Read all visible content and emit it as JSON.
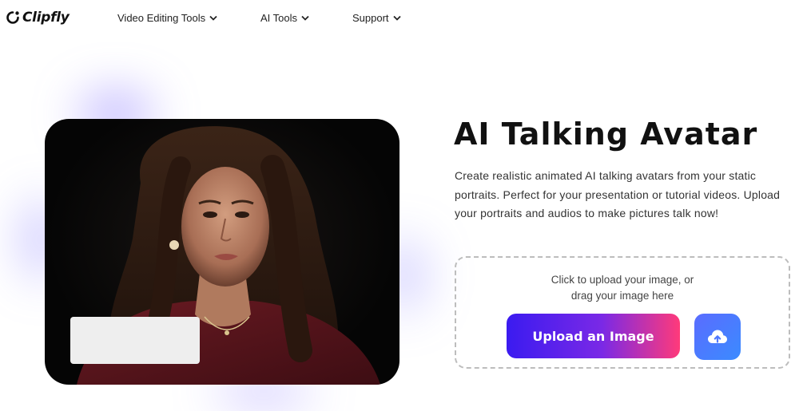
{
  "brand": {
    "name": "Clipfly"
  },
  "nav": {
    "items": [
      {
        "label": "Video Editing Tools",
        "icon": "chevron-down-icon"
      },
      {
        "label": "AI Tools",
        "icon": "chevron-down-icon"
      },
      {
        "label": "Support",
        "icon": "chevron-down-icon"
      }
    ]
  },
  "hero": {
    "title": "AI Talking Avatar",
    "description": "Create realistic animated AI talking avatars from your static portraits. Perfect for your presentation or tutorial videos. Upload your portraits and audios to make pictures talk now!",
    "upload": {
      "hint_line1": "Click to upload your image, or",
      "hint_line2": "drag your image here",
      "button_label": "Upload an Image",
      "cloud_icon": "cloud-upload-icon"
    }
  },
  "colors": {
    "accent_gradient_start": "#3b1bf0",
    "accent_gradient_end": "#ff3a7a",
    "cloud_button": "#4f78ff"
  }
}
